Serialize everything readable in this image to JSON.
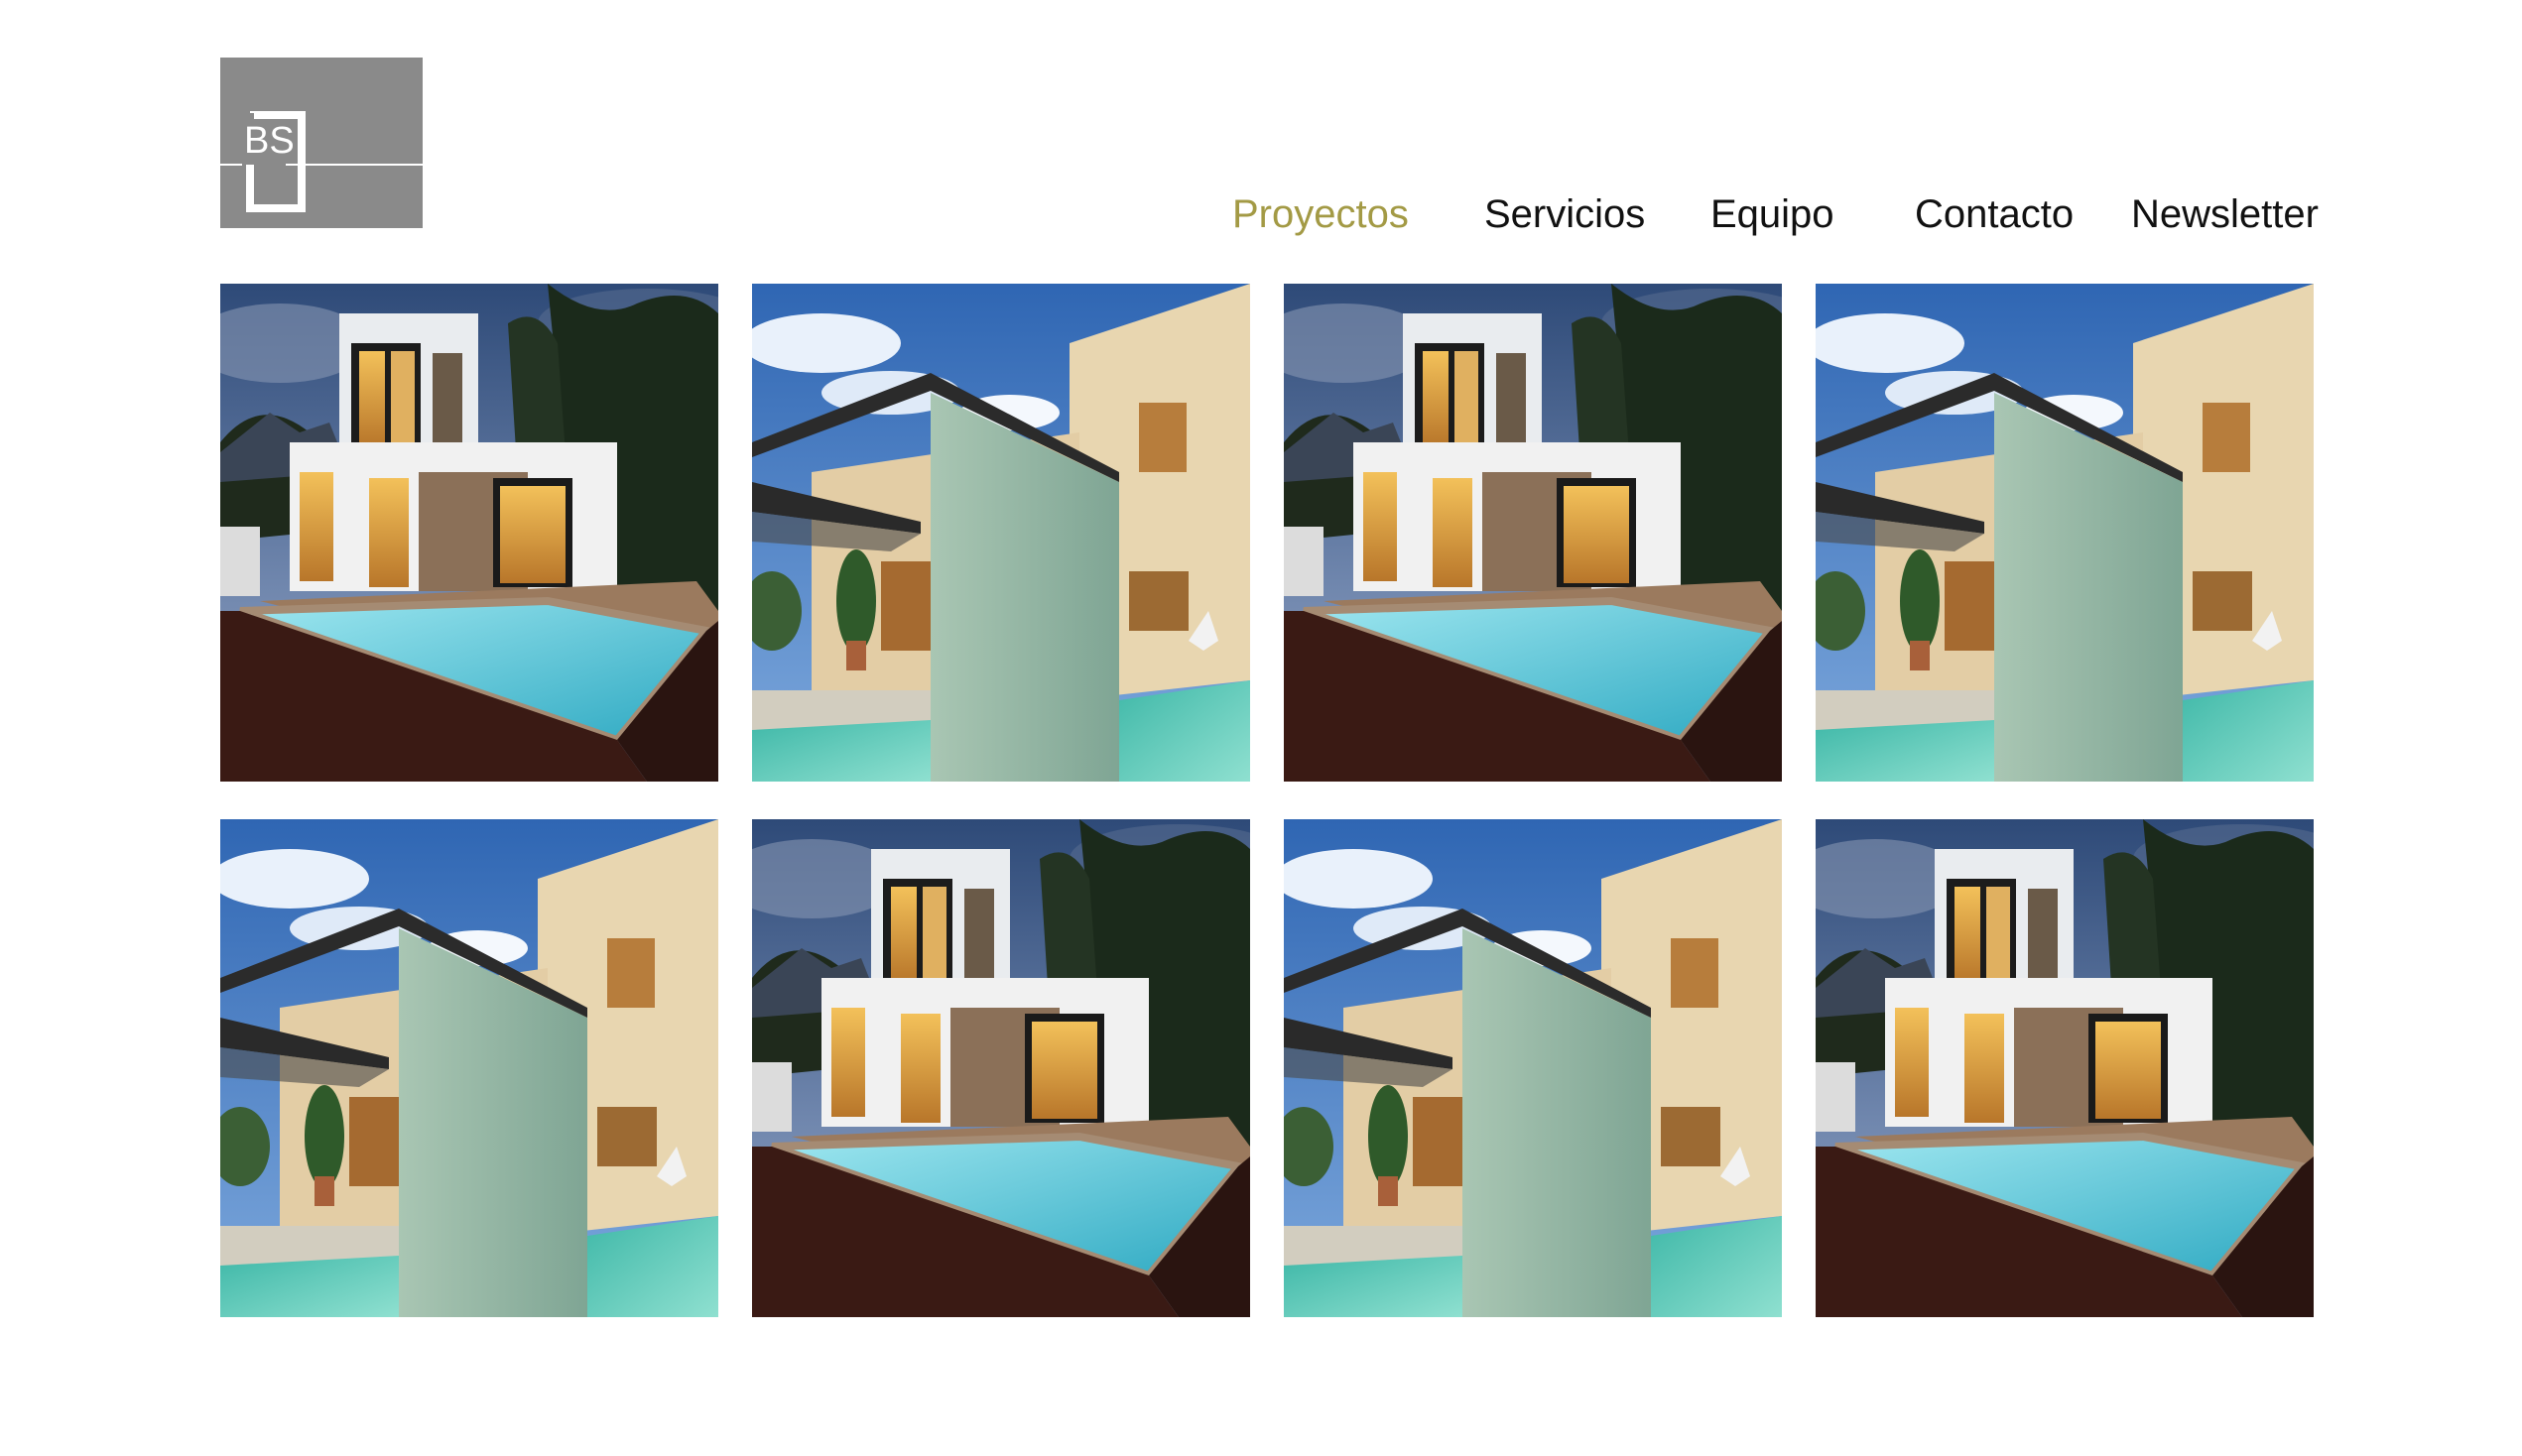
{
  "logo": {
    "text": "BS"
  },
  "nav": {
    "active": "Proyectos",
    "items": [
      {
        "label": "Proyectos"
      },
      {
        "label": "Servicios"
      },
      {
        "label": "Equipo"
      },
      {
        "label": "Contacto"
      },
      {
        "label": "Newsletter"
      }
    ]
  },
  "colors": {
    "nav_active": "#a39a45",
    "nav_default": "#111111",
    "logo_bg": "#8a8a8a"
  },
  "gallery": {
    "tiles": [
      {
        "variant": "night-house-pool"
      },
      {
        "variant": "day-wall-pool"
      },
      {
        "variant": "night-house-pool"
      },
      {
        "variant": "day-wall-pool"
      },
      {
        "variant": "day-wall-pool"
      },
      {
        "variant": "night-house-pool"
      },
      {
        "variant": "day-wall-pool"
      },
      {
        "variant": "night-house-pool"
      }
    ]
  }
}
